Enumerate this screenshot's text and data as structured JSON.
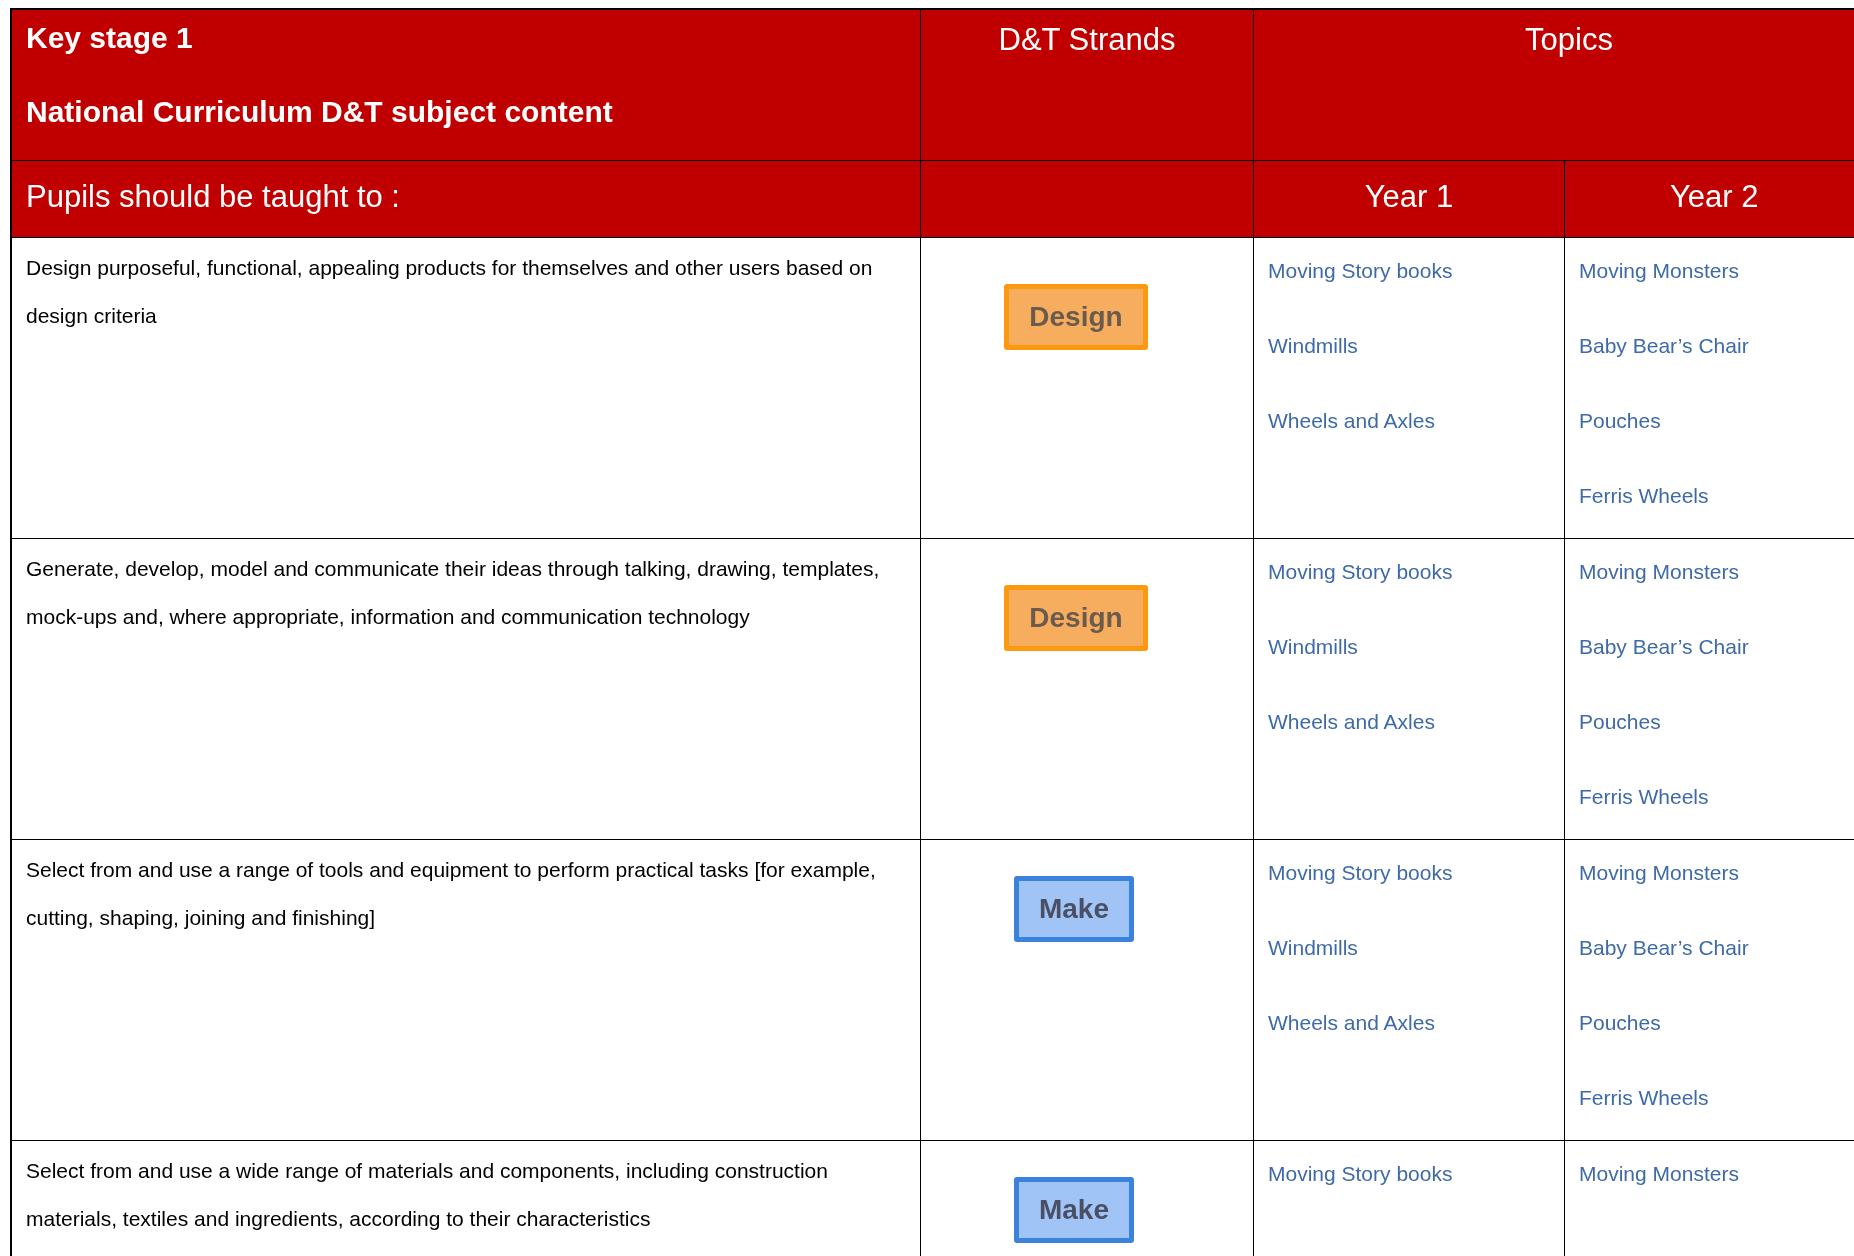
{
  "header": {
    "title": "Key stage 1",
    "subtitle": "National Curriculum D&T subject content",
    "strands_heading": "D&T Strands",
    "topics_heading": "Topics",
    "intro": "Pupils should be taught to :",
    "year_1": "Year 1",
    "year_2": "Year 2"
  },
  "rows": [
    {
      "statement": "Design purposeful, functional, appealing products for themselves and other users based on design criteria",
      "strand": {
        "kind": "design",
        "label": "Design"
      },
      "year_1": [
        "Moving Story books",
        "Windmills",
        "Wheels and Axles"
      ],
      "year_2": [
        "Moving Monsters",
        "Baby Bear’s Chair",
        "Pouches",
        "Ferris Wheels"
      ]
    },
    {
      "statement": "Generate, develop, model and communicate their ideas through talking, drawing, templates, mock-ups and, where appropriate, information and communication technology",
      "strand": {
        "kind": "design",
        "label": "Design"
      },
      "year_1": [
        "Moving Story books",
        "Windmills",
        "Wheels and Axles"
      ],
      "year_2": [
        "Moving Monsters",
        "Baby Bear’s Chair",
        "Pouches",
        "Ferris Wheels"
      ]
    },
    {
      "statement": "Select from and use a range of tools and equipment to perform practical tasks [for example, cutting, shaping, joining and finishing]",
      "strand": {
        "kind": "make",
        "label": "Make"
      },
      "year_1": [
        "Moving Story books",
        "Windmills",
        "Wheels and Axles"
      ],
      "year_2": [
        "Moving Monsters",
        "Baby Bear’s Chair",
        "Pouches",
        "Ferris Wheels"
      ]
    },
    {
      "statement": "Select from and use a wide range of materials and components, including construction materials, textiles and ingredients, according to their characteristics",
      "strand": {
        "kind": "make",
        "label": "Make"
      },
      "year_1": [
        "Moving Story books"
      ],
      "year_2": [
        "Moving Monsters"
      ]
    }
  ]
}
